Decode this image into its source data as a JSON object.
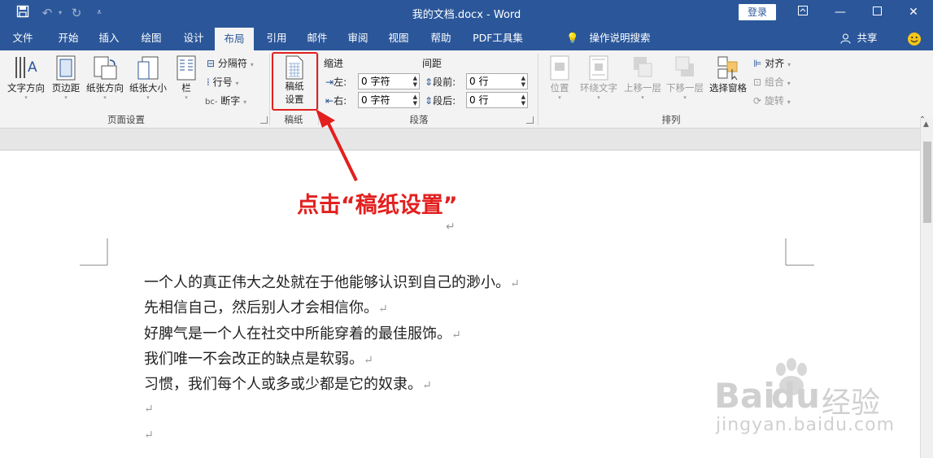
{
  "window": {
    "title": "我的文档.docx - Word",
    "login": "登录",
    "share": "共享",
    "icons": [
      "save-icon",
      "undo-icon",
      "redo-icon",
      "customize-qat-icon",
      "ribbon-display-icon",
      "minimize-icon",
      "maximize-icon",
      "close-icon",
      "smiley-icon",
      "user-icon",
      "lightbulb-icon"
    ]
  },
  "tabs": [
    "文件",
    "开始",
    "插入",
    "绘图",
    "设计",
    "布局",
    "引用",
    "邮件",
    "审阅",
    "视图",
    "帮助",
    "PDF工具集"
  ],
  "active_tab": "布局",
  "tellme": "操作说明搜索",
  "ribbon": {
    "page_setup": {
      "group_label": "页面设置",
      "text_direction": "文字方向",
      "margins": "页边距",
      "orientation": "纸张方向",
      "size": "纸张大小",
      "columns": "栏",
      "breaks": "分隔符",
      "line_numbers": "行号",
      "hyphenation": "断字"
    },
    "manuscript": {
      "group_label": "稿纸",
      "line1": "稿纸",
      "line2": "设置"
    },
    "paragraph": {
      "group_label": "段落",
      "indent_title": "缩进",
      "spacing_title": "间距",
      "left_label": "左:",
      "left_value": "0 字符",
      "right_label": "右:",
      "right_value": "0 字符",
      "before_label": "段前:",
      "before_value": "0 行",
      "after_label": "段后:",
      "after_value": "0 行"
    },
    "arrange": {
      "group_label": "排列",
      "position": "位置",
      "wrap_text": "环绕文字",
      "bring_forward": "上移一层",
      "send_backward": "下移一层",
      "selection_pane": "选择窗格",
      "align": "对齐",
      "group": "组合",
      "rotate": "旋转"
    }
  },
  "annotation": {
    "text": "点击“稿纸设置”",
    "color": "#e2201f"
  },
  "document": {
    "paragraph_mark": "↵",
    "lines": [
      "一个人的真正伟大之处就在于他能够认识到自己的渺小。",
      "先相信自己，然后别人才会相信你。",
      "好脾气是一个人在社交中所能穿着的最佳服饰。",
      "我们唯一不会改正的缺点是软弱。",
      "习惯，我们每个人或多或少都是它的奴隶。"
    ]
  },
  "watermark": {
    "brand": "Bai",
    "brand2": "du",
    "cn": "经验",
    "url": "jingyan.baidu.com"
  },
  "colors": {
    "word_blue": "#2b579a",
    "ribbon_bg": "#f3f3f3",
    "red": "#e2201f"
  }
}
